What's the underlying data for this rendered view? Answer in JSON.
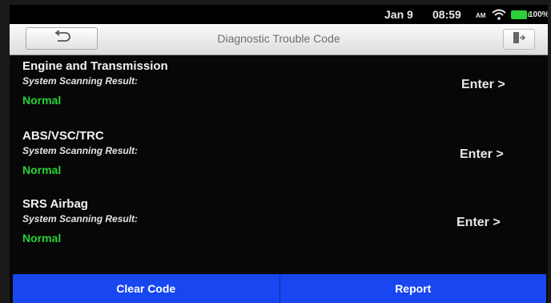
{
  "status_bar": {
    "date": "Jan 9",
    "time": "08:59",
    "ampm": "AM",
    "battery_percent": "100%",
    "icons": [
      "wifi-icon",
      "battery-icon"
    ]
  },
  "header": {
    "title": "Diagnostic Trouble Code",
    "back_icon": "back-arrow-icon",
    "exit_icon": "exit-door-icon"
  },
  "systems": [
    {
      "name": "Engine and Transmission",
      "subtitle": "System Scanning Result:",
      "status": "Normal",
      "action": "Enter >"
    },
    {
      "name": "ABS/VSC/TRC",
      "subtitle": "System Scanning Result:",
      "status": "Normal",
      "action": "Enter >"
    },
    {
      "name": "SRS Airbag",
      "subtitle": "System Scanning Result:",
      "status": "Normal",
      "action": "Enter >"
    }
  ],
  "footer": {
    "clear_label": "Clear Code",
    "report_label": "Report"
  },
  "colors": {
    "status_ok": "#28d23a",
    "footer_bg": "#1846f0",
    "screen_bg": "#070707"
  }
}
